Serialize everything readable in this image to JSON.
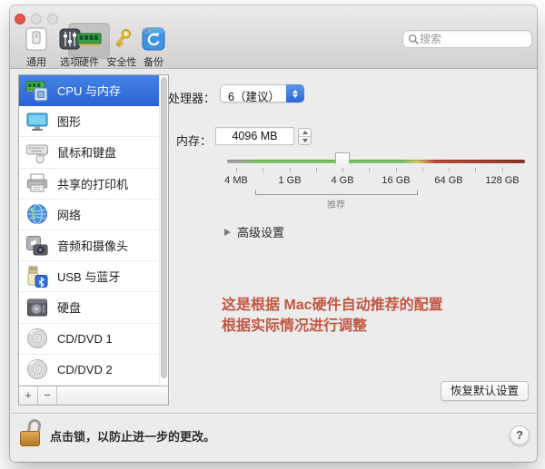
{
  "window": {
    "toolbar": {
      "items": [
        {
          "label": "通用"
        },
        {
          "label": "选项"
        },
        {
          "label": "硬件"
        },
        {
          "label": "安全性"
        },
        {
          "label": "备份"
        }
      ],
      "selected": "硬件",
      "search_placeholder": "搜索"
    },
    "sidebar": {
      "items": [
        {
          "label": "CPU 与内存",
          "selected": true
        },
        {
          "label": "图形"
        },
        {
          "label": "鼠标和键盘"
        },
        {
          "label": "共享的打印机"
        },
        {
          "label": "网络"
        },
        {
          "label": "音频和摄像头"
        },
        {
          "label": "USB 与蓝牙"
        },
        {
          "label": "硬盘"
        },
        {
          "label": "CD/DVD 1"
        },
        {
          "label": "CD/DVD 2"
        }
      ],
      "add_label": "+",
      "remove_label": "−"
    },
    "main": {
      "processor_label": "处理器：",
      "processor_value": "6（建议）",
      "memory_label": "内存：",
      "memory_value": "4096 MB",
      "slider": {
        "labels": [
          "4 MB",
          "1 GB",
          "4 GB",
          "16 GB",
          "64 GB",
          "128 GB"
        ],
        "value": "4 GB",
        "recommended_label": "推荐"
      },
      "advanced_label": "高级设置",
      "annotation_line1": "这是根据 Mac硬件自动推荐的配置",
      "annotation_line2": "根据实际情况进行调整",
      "restore_button": "恢复默认设置"
    },
    "footer": {
      "lock_text": "点击锁，以防止进一步的更改。",
      "help_label": "?"
    },
    "colors": {
      "selection_blue": "#3174dc",
      "annotation_red": "#c25744",
      "slider_green": "#7cc468",
      "slider_red": "#9e3a2f",
      "close_button_red": "#e2564a"
    }
  }
}
